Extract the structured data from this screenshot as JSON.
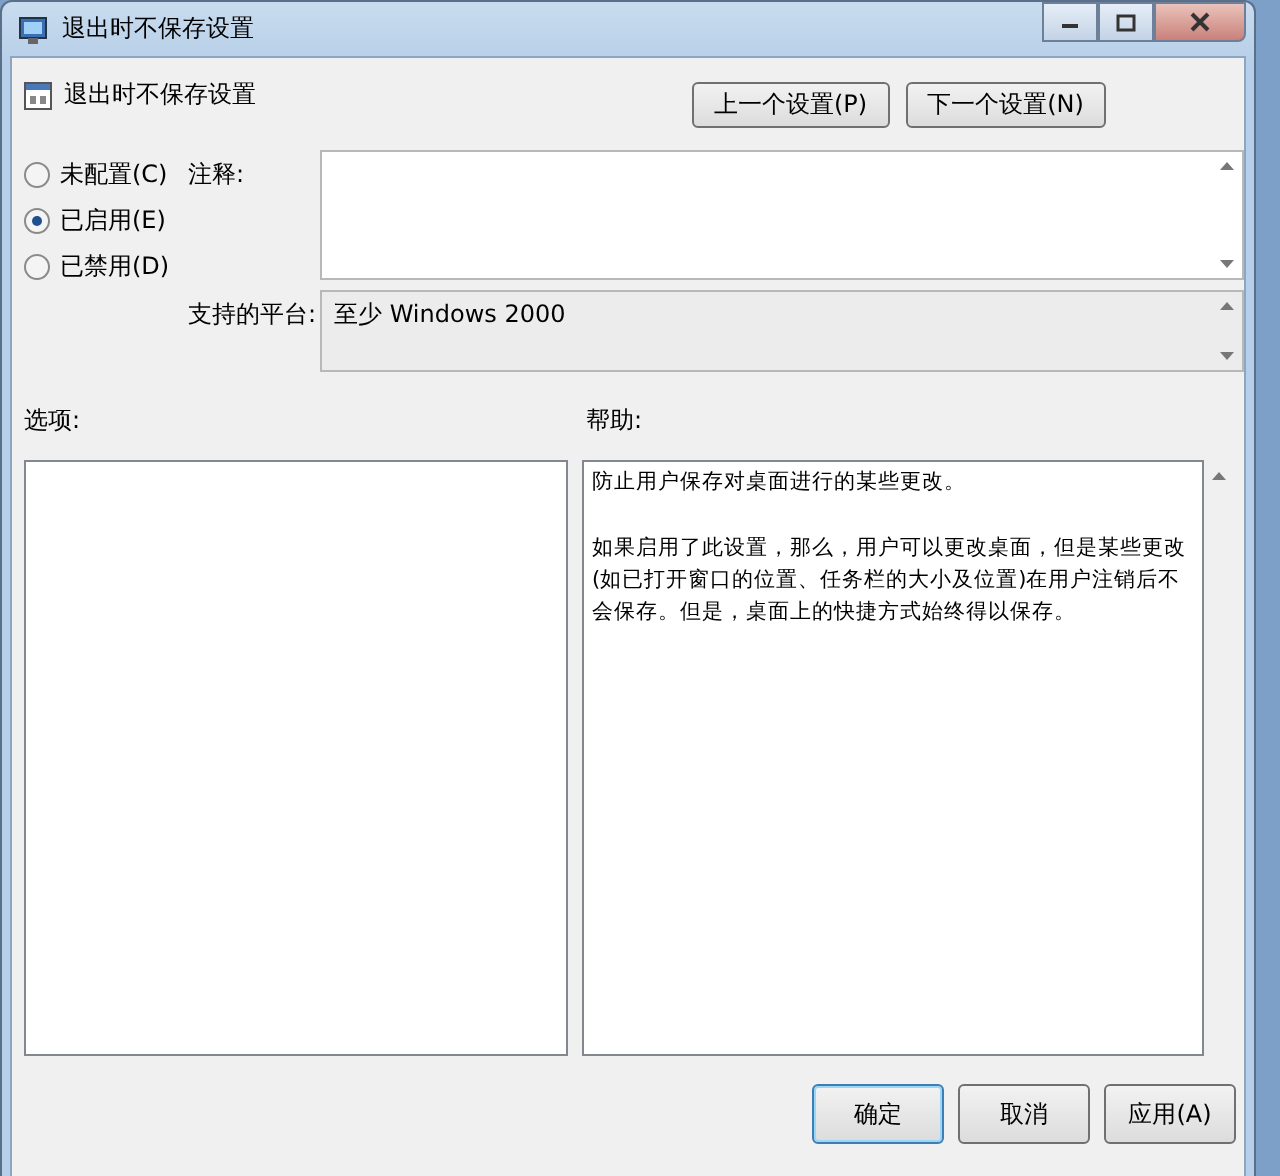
{
  "window": {
    "title": "退出时不保存设置"
  },
  "setting_title": "退出时不保存设置",
  "nav_buttons": [
    "上一个设置(P)",
    "下一个设置(N)"
  ],
  "states": [
    {
      "label": "未配置(C)",
      "selected": false
    },
    {
      "label": "已启用(E)",
      "selected": true
    },
    {
      "label": "已禁用(D)",
      "selected": false
    }
  ],
  "comment": {
    "label": "注释:"
  },
  "platform": {
    "label": "支持的平台:",
    "value": "至少 Windows 2000"
  },
  "options": {
    "label": "选项:"
  },
  "help": {
    "label": "帮助:",
    "paragraphs": [
      "防止用户保存对桌面进行的某些更改。",
      "如果启用了此设置，那么，用户可以更改桌面，但是某些更改(如已打开窗口的位置、任务栏的大小及位置)在用户注销后不会保存。但是，桌面上的快捷方式始终得以保存。"
    ]
  },
  "buttons": [
    {
      "label": "确定",
      "default": true
    },
    {
      "label": "取消",
      "default": false
    },
    {
      "label": "应用(A)",
      "default": false
    }
  ]
}
